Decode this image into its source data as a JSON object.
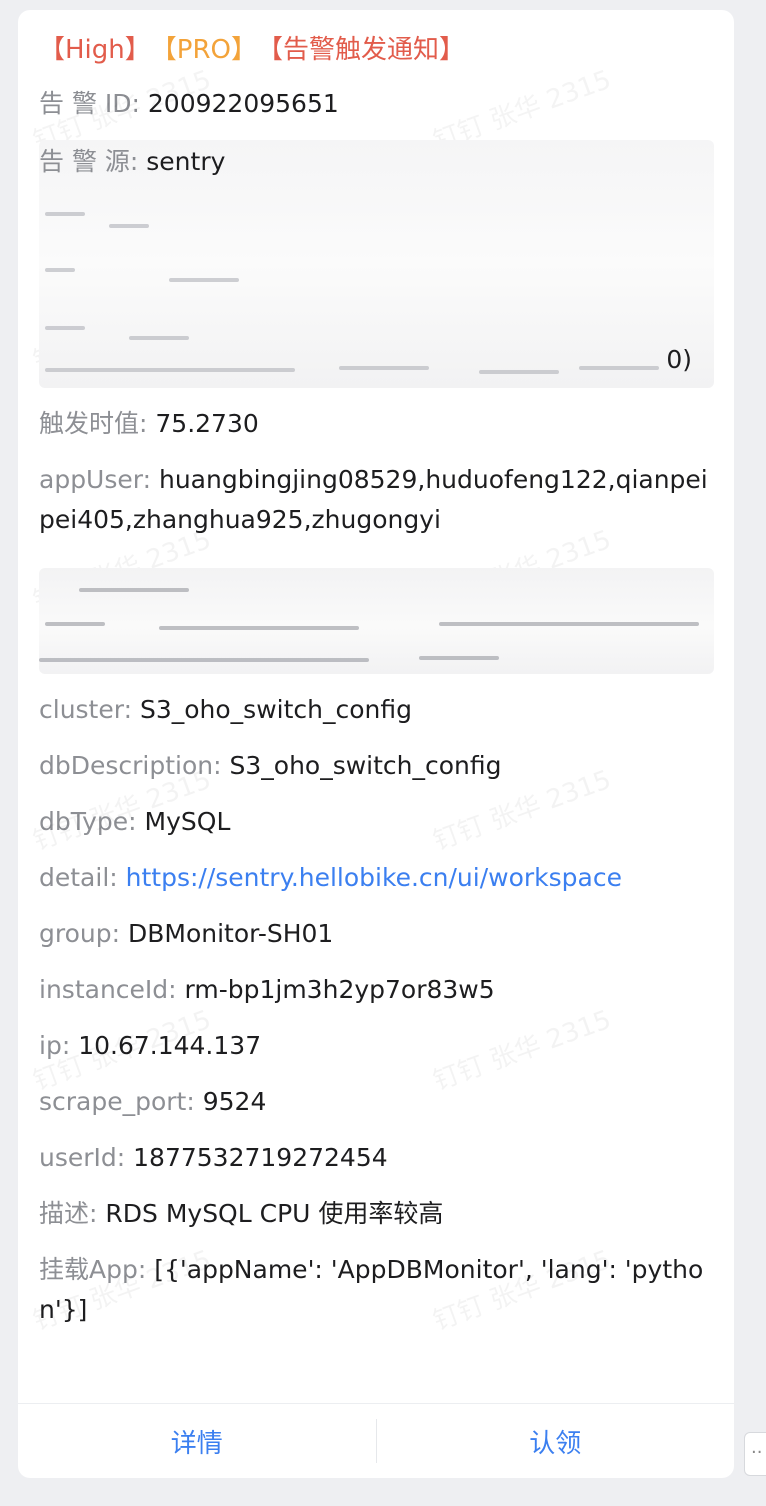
{
  "card": {
    "tags": {
      "severity": "【High】",
      "env": "【PRO】",
      "type": "【告警触发通知】"
    },
    "fields": {
      "alert_id": {
        "key": "告 警 ID:",
        "value": "200922095651"
      },
      "alert_source": {
        "key": "告 警 源:",
        "value": "sentry"
      },
      "redacted_tail": "0)",
      "trigger_value": {
        "key": "触发时值:",
        "value": "75.2730"
      },
      "app_user": {
        "key": "appUser:",
        "value": "huangbingjing08529,huduofeng122,qianpeipei405,zhanghua925,zhugongyi"
      },
      "cluster": {
        "key": "cluster:",
        "value": "S3_oho_switch_config"
      },
      "db_description": {
        "key": "dbDescription:",
        "value": "S3_oho_switch_config"
      },
      "db_type": {
        "key": "dbType:",
        "value": "MySQL"
      },
      "detail": {
        "key": "detail:",
        "value": "https://sentry.hellobike.cn/ui/workspace"
      },
      "group": {
        "key": "group:",
        "value": "DBMonitor-SH01"
      },
      "instance_id": {
        "key": "instanceId:",
        "value": "rm-bp1jm3h2yp7or83w5"
      },
      "ip": {
        "key": "ip:",
        "value": "10.67.144.137"
      },
      "scrape_port": {
        "key": "scrape_port:",
        "value": "9524"
      },
      "user_id": {
        "key": "userId:",
        "value": "1877532719272454"
      },
      "description": {
        "key": "描述:",
        "value": "RDS MySQL CPU 使用率较高"
      },
      "mounted_app": {
        "key": "挂载App:",
        "value": "[{'appName': 'AppDBMonitor', 'lang': 'python'}]"
      }
    },
    "buttons": {
      "details": "详情",
      "claim": "认领"
    },
    "watermark": "钉钉 张华 2315"
  },
  "colors": {
    "high": "#e25c4b",
    "pro": "#f3a33a",
    "link": "#3b7ff0",
    "key": "#8d8f94"
  }
}
